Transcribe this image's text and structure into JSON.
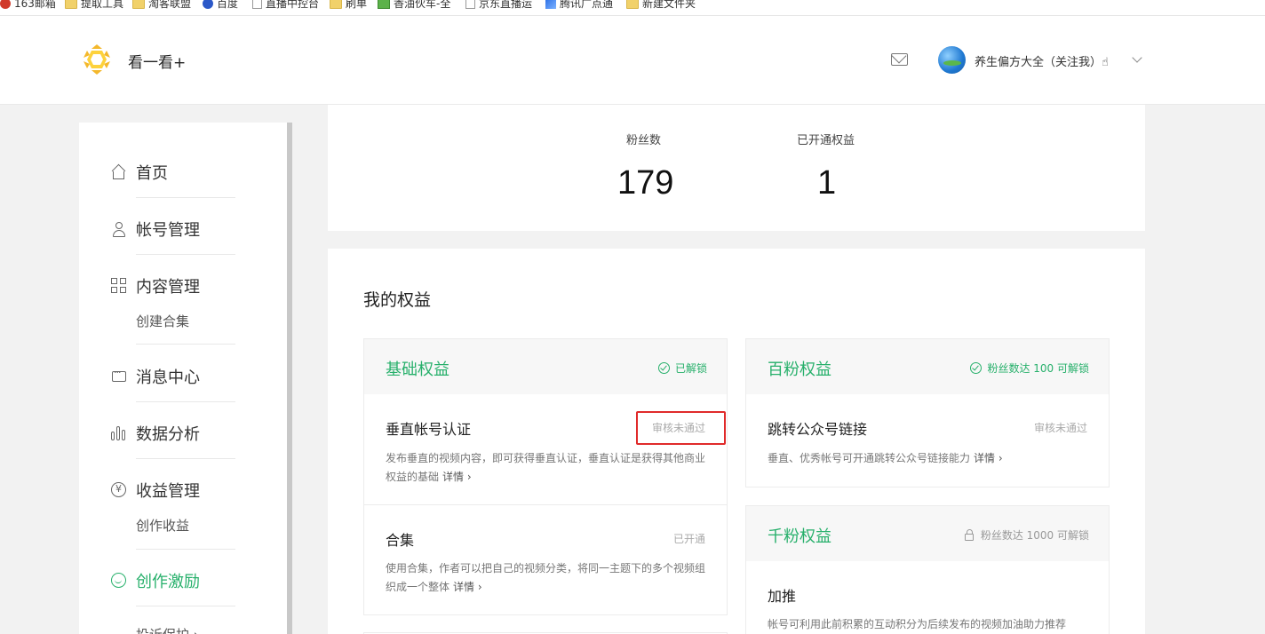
{
  "bookmarks": [
    {
      "label": "163邮箱",
      "icon": "mail-163-icon"
    },
    {
      "label": "提取工具",
      "icon": "folder-icon"
    },
    {
      "label": "淘客联盟",
      "icon": "folder-icon"
    },
    {
      "label": "百度",
      "icon": "baidu-icon"
    },
    {
      "label": "直播中控台",
      "icon": "page-icon"
    },
    {
      "label": "刷单",
      "icon": "folder-icon"
    },
    {
      "label": "香油伙车-全",
      "icon": "sheet-icon"
    },
    {
      "label": "京东直播运",
      "icon": "page-icon"
    },
    {
      "label": "腾讯广点通",
      "icon": "tencent-icon"
    },
    {
      "label": "新建文件夹",
      "icon": "folder-icon"
    }
  ],
  "header": {
    "brand": "看一看+",
    "username": "养生偏方大全（关注我）☝",
    "colors": {
      "accent": "#27b06b",
      "logo": "#f4b82c"
    }
  },
  "sidebar": {
    "items": [
      {
        "label": "首页"
      },
      {
        "label": "帐号管理"
      },
      {
        "label": "内容管理",
        "sub": "创建合集"
      },
      {
        "label": "消息中心"
      },
      {
        "label": "数据分析"
      },
      {
        "label": "收益管理",
        "sub": "创作收益"
      },
      {
        "label": "创作激励",
        "active": true,
        "sub": "投诉保护 ›"
      }
    ]
  },
  "stats": {
    "fans_label": "粉丝数",
    "fans_value": "179",
    "rights_label": "已开通权益",
    "rights_value": "1"
  },
  "rights": {
    "title": "我的权益",
    "basic": {
      "title": "基础权益",
      "status": "已解锁",
      "items": [
        {
          "title": "垂直帐号认证",
          "status": "审核未通过",
          "desc": "发布垂直的视频内容，即可获得垂直认证，垂直认证是获得其他商业权益的基础",
          "link": "详情 ›"
        },
        {
          "title": "合集",
          "status": "已开通",
          "desc": "使用合集，作者可以把自己的视频分类，将同一主题下的多个视频组织成一个整体",
          "link": "详情 ›"
        }
      ]
    },
    "hundred": {
      "title": "百粉权益",
      "status": "粉丝数达 100 可解锁",
      "items": [
        {
          "title": "跳转公众号链接",
          "status": "审核未通过",
          "desc": "垂直、优秀帐号可开通跳转公众号链接能力",
          "link": "详情 ›"
        }
      ]
    },
    "thousand": {
      "title": "千粉权益",
      "status": "粉丝数达 1000 可解锁",
      "items": [
        {
          "title": "加推",
          "desc": "帐号可利用此前积累的互动积分为后续发布的视频加油助力推荐"
        }
      ]
    }
  }
}
